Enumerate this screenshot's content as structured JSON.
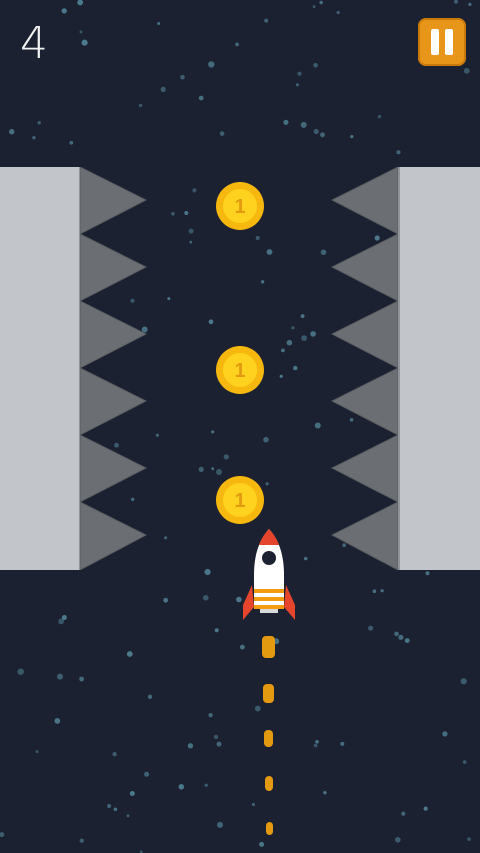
{
  "hud": {
    "score": "4",
    "pause_icon": "pause-icon"
  },
  "colors": {
    "background": "#1b2130",
    "star": "#4f7f92",
    "wall": "#c2c6cb",
    "spike": "#6b6e72",
    "coin": "#f6b80f",
    "coin_inner": "#ffd21f",
    "pause_button": "#e8961a",
    "rocket_body": "#ffffff",
    "rocket_accent": "#e4452c",
    "rocket_stripe": "#f39c12",
    "flame": "#e39a10"
  },
  "coins": [
    {
      "label": "1"
    },
    {
      "label": "1"
    },
    {
      "label": "1"
    }
  ],
  "rocket": {
    "icon": "rocket-icon"
  }
}
